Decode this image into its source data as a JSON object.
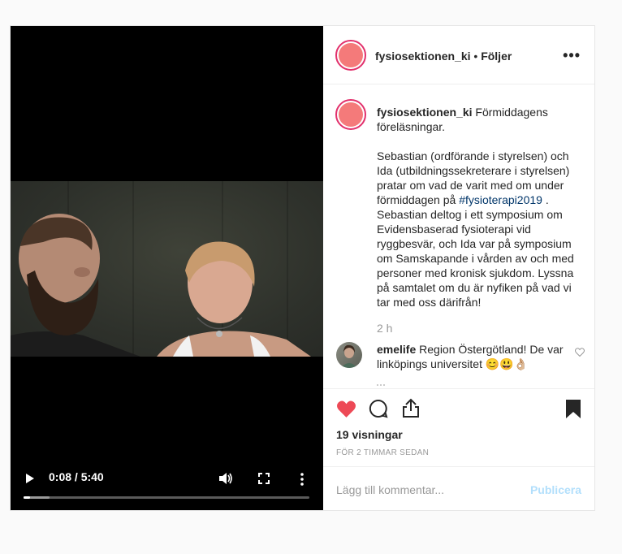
{
  "video": {
    "time_display": "0:08 / 5:40",
    "progress_played": 0.024,
    "progress_buffered": 0.09
  },
  "header": {
    "username": "fysiosektionen_ki",
    "separator": "•",
    "follow_status": "Följer",
    "more_label": "•••"
  },
  "caption": {
    "username": "fysiosektionen_ki",
    "line1": "Förmiddagens föreläsningar.",
    "para_before_tag": "Sebastian (ordförande i styrelsen) och Ida (utbildningssekreterare i styrelsen) pratar om vad de varit med om under förmiddagen på",
    "hashtag": "#fysioterapi2019",
    "para_after_tag": ". Sebastian deltog i ett symposium om Evidensbaserad fysioterapi vid ryggbesvär, och Ida var på symposium om Samskapande i vården av och med personer med kronisk sjukdom. Lyssna på samtalet om du är nyfiken på vad vi tar med oss därifrån!",
    "time_ago": "2 h"
  },
  "comment": {
    "username": "emelife",
    "text": "Region Östergötland! De var linköpings universitet 😊😃👌🏼"
  },
  "actions": {
    "views": "19 visningar",
    "date": "FÖR 2 TIMMAR SEDAN",
    "like_color": "#ed4956"
  },
  "add_comment": {
    "placeholder": "Lägg till kommentar...",
    "publish_label": "Publicera"
  }
}
